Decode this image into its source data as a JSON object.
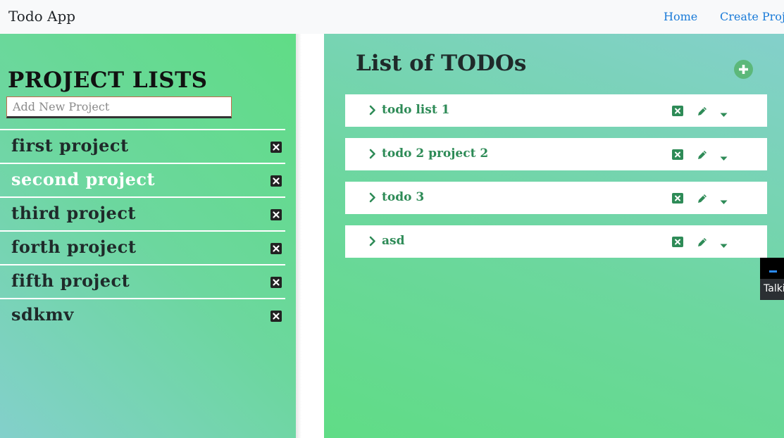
{
  "navbar": {
    "brand": "Todo App",
    "links": [
      "Home",
      "Create Proj"
    ]
  },
  "left": {
    "title": "PROJECT LISTS",
    "input_placeholder": "Add New Project",
    "projects": [
      {
        "name": "first project",
        "active": false
      },
      {
        "name": "second project",
        "active": true
      },
      {
        "name": "third project",
        "active": false
      },
      {
        "name": "forth project",
        "active": false
      },
      {
        "name": "fifth project",
        "active": false
      },
      {
        "name": "sdkmv",
        "active": false
      }
    ]
  },
  "right": {
    "title": "List of TODOs",
    "todos": [
      {
        "label": "todo list 1"
      },
      {
        "label": "todo 2 project 2"
      },
      {
        "label": "todo 3"
      },
      {
        "label": "asd"
      }
    ]
  },
  "chat": {
    "text": "Talki"
  },
  "icons": {
    "delete": "close-square-icon",
    "edit": "pencil-icon",
    "expand": "chevron-right-icon",
    "menu": "caret-down-icon",
    "add": "plus-circle-icon"
  },
  "colors": {
    "accent_green": "#2e8b57",
    "link_blue": "#1a7bd8",
    "active_project": "#ffffff"
  }
}
